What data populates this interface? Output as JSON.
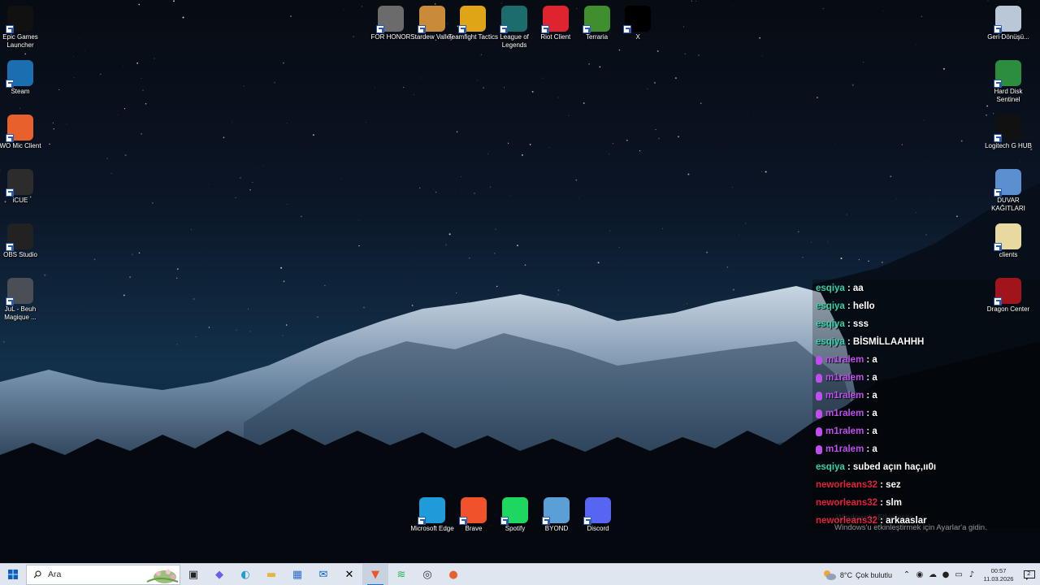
{
  "desktop": {
    "left_icons": [
      {
        "label": "Epic Games Launcher",
        "icon": "epic-games-icon",
        "color": "#111111"
      },
      {
        "label": "Steam",
        "icon": "steam-icon",
        "color": "#1b6fb0"
      },
      {
        "label": "WO Mic Client",
        "icon": "microphone-icon",
        "color": "#e8612c"
      },
      {
        "label": "iCUE",
        "icon": "icue-icon",
        "color": "#2c2c2c"
      },
      {
        "label": "OBS Studio",
        "icon": "obs-icon",
        "color": "#222222"
      },
      {
        "label": "JuL - Beuh Magique ...",
        "icon": "video-thumbnail-icon",
        "color": "#4b4f55"
      }
    ],
    "top_icons": [
      {
        "label": "FOR HONOR",
        "icon": "for-honor-icon",
        "color": "#6b6b6b"
      },
      {
        "label": "Stardew Valley",
        "icon": "stardew-valley-icon",
        "color": "#c98a3a"
      },
      {
        "label": "Teamfight Tactics",
        "icon": "teamfight-tactics-icon",
        "color": "#e0a417"
      },
      {
        "label": "League of Legends",
        "icon": "league-of-legends-icon",
        "color": "#1a6d6a"
      },
      {
        "label": "Riot Client",
        "icon": "riot-client-icon",
        "color": "#e0242f"
      },
      {
        "label": "Terraria",
        "icon": "terraria-icon",
        "color": "#3f8f2f"
      },
      {
        "label": "X",
        "icon": "x-logo-icon",
        "color": "#000000"
      }
    ],
    "right_icons": [
      {
        "label": "Geri Dönüşü...",
        "icon": "recycle-bin-icon",
        "color": "#b9c7d6"
      },
      {
        "label": "Hard Disk Sentinel",
        "icon": "hard-disk-sentinel-icon",
        "color": "#2d8d3e"
      },
      {
        "label": "Logitech G HUB",
        "icon": "logitech-g-icon",
        "color": "#111111"
      },
      {
        "label": "DUVAR KAĞITLARI",
        "icon": "folder-wallpapers-icon",
        "color": "#5a8fd0"
      },
      {
        "label": "clients",
        "icon": "clients-file-icon",
        "color": "#e8d9a0"
      },
      {
        "label": "Dragon Center",
        "icon": "dragon-center-icon",
        "color": "#a0141c"
      }
    ],
    "bottom_icons": [
      {
        "label": "Microsoft Edge",
        "icon": "edge-icon",
        "color": "#1e9bd8"
      },
      {
        "label": "Brave",
        "icon": "brave-icon",
        "color": "#f0532b"
      },
      {
        "label": "Spotify",
        "icon": "spotify-icon",
        "color": "#1ed760"
      },
      {
        "label": "BYOND",
        "icon": "byond-icon",
        "color": "#5a9fd6"
      },
      {
        "label": "Discord",
        "icon": "discord-icon",
        "color": "#5865f2"
      }
    ]
  },
  "chat": {
    "messages": [
      {
        "user": "esqiya",
        "text": ": aa",
        "color": "#2fd6b0",
        "badge": false
      },
      {
        "user": "esqiya",
        "text": ": hello",
        "color": "#2fd6b0",
        "badge": false
      },
      {
        "user": "esqiya",
        "text": ": sss",
        "color": "#2fd6b0",
        "badge": false
      },
      {
        "user": "esqiya",
        "text": ": BİSMİLLAAHHH",
        "color": "#2fd6b0",
        "badge": false
      },
      {
        "user": "m1ralem",
        "text": ": a",
        "color": "#c04df0",
        "badge": true
      },
      {
        "user": "m1ralem",
        "text": ": a",
        "color": "#c04df0",
        "badge": true
      },
      {
        "user": "m1ralem",
        "text": ": a",
        "color": "#c04df0",
        "badge": true
      },
      {
        "user": "m1ralem",
        "text": ": a",
        "color": "#c04df0",
        "badge": true
      },
      {
        "user": "m1ralem",
        "text": ": a",
        "color": "#c04df0",
        "badge": true
      },
      {
        "user": "m1ralem",
        "text": ": a",
        "color": "#c04df0",
        "badge": true
      },
      {
        "user": "esqiya",
        "text": ": subed açın haç,ıı0ı",
        "color": "#2fd6b0",
        "badge": false
      },
      {
        "user": "neworleans32",
        "text": ": sez",
        "color": "#e0243c",
        "badge": false
      },
      {
        "user": "neworleans32",
        "text": ": slm",
        "color": "#e0243c",
        "badge": false
      },
      {
        "user": "neworleans32",
        "text": ": arkaaslar",
        "color": "#e0243c",
        "badge": false
      }
    ]
  },
  "activation": {
    "title": "Windows'u Etkinleştir",
    "subtitle": "Windows'u etkinleştirmek için Ayarlar'a gidin."
  },
  "taskbar": {
    "search_placeholder": "Ara",
    "apps": [
      {
        "name": "task-view",
        "icon": "task-view-icon",
        "active": false
      },
      {
        "name": "copilot",
        "icon": "copilot-icon",
        "active": false
      },
      {
        "name": "edge",
        "icon": "edge-icon",
        "active": false
      },
      {
        "name": "file-explorer",
        "icon": "folder-icon",
        "active": false
      },
      {
        "name": "microsoft-store",
        "icon": "store-icon",
        "active": false
      },
      {
        "name": "outlook",
        "icon": "outlook-icon",
        "active": false
      },
      {
        "name": "x",
        "icon": "x-logo-icon",
        "active": false
      },
      {
        "name": "brave",
        "icon": "brave-icon",
        "active": true
      },
      {
        "name": "spotify",
        "icon": "spotify-icon",
        "active": false
      },
      {
        "name": "obs",
        "icon": "obs-icon",
        "active": false
      },
      {
        "name": "wo-mic",
        "icon": "microphone-icon",
        "active": false
      }
    ],
    "weather": {
      "temp": "8°C",
      "desc": "Çok bulutlu"
    },
    "time": "00:57",
    "date": "11.03.2026",
    "notification_count": "2"
  }
}
